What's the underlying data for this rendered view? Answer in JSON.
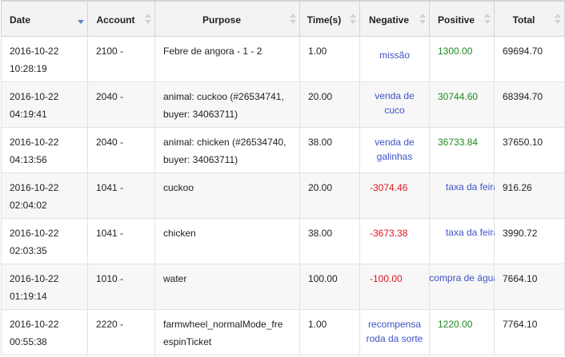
{
  "columns": [
    {
      "key": "date",
      "label": "Date",
      "sorted": true
    },
    {
      "key": "account",
      "label": "Account",
      "sorted": false
    },
    {
      "key": "purpose",
      "label": "Purpose",
      "sorted": false
    },
    {
      "key": "time",
      "label": "Time(s)",
      "sorted": false
    },
    {
      "key": "negative",
      "label": "Negative",
      "sorted": false
    },
    {
      "key": "positive",
      "label": "Positive",
      "sorted": false
    },
    {
      "key": "total",
      "label": "Total",
      "sorted": false
    }
  ],
  "rows": [
    {
      "date": "2016-10-22",
      "time_of_day": "10:28:19",
      "account": "2100 -",
      "purpose": [
        "Febre de angora - 1 - 2"
      ],
      "seconds": "1.00",
      "negative": "",
      "negative_note": "missão",
      "positive": "1300.00",
      "positive_note": "",
      "total": "69694.70"
    },
    {
      "date": "2016-10-22",
      "time_of_day": "04:19:41",
      "account": "2040 -",
      "purpose": [
        "animal: cuckoo (#26534741,",
        "buyer: 34063711)"
      ],
      "seconds": "20.00",
      "negative": "",
      "negative_note": "venda de cuco",
      "positive": "30744.60",
      "positive_note": "",
      "total": "68394.70"
    },
    {
      "date": "2016-10-22",
      "time_of_day": "04:13:56",
      "account": "2040 -",
      "purpose": [
        "animal: chicken (#26534740,",
        "buyer: 34063711)"
      ],
      "seconds": "38.00",
      "negative": "",
      "negative_note": "venda de galinhas",
      "positive": "36733.84",
      "positive_note": "",
      "total": "37650.10"
    },
    {
      "date": "2016-10-22",
      "time_of_day": "02:04:02",
      "account": "1041 -",
      "purpose": [
        "cuckoo"
      ],
      "seconds": "20.00",
      "negative": "-3074.46",
      "negative_note": "",
      "positive": "",
      "positive_note": "taxa da feira",
      "total": "916.26"
    },
    {
      "date": "2016-10-22",
      "time_of_day": "02:03:35",
      "account": "1041 -",
      "purpose": [
        "chicken"
      ],
      "seconds": "38.00",
      "negative": "-3673.38",
      "negative_note": "",
      "positive": "",
      "positive_note": "taxa da feira",
      "total": "3990.72"
    },
    {
      "date": "2016-10-22",
      "time_of_day": "01:19:14",
      "account": "1010 -",
      "purpose": [
        "water"
      ],
      "seconds": "100.00",
      "negative": "-100.00",
      "negative_note": "",
      "positive": "",
      "positive_note": "compra de água",
      "total": "7664.10"
    },
    {
      "date": "2016-10-22",
      "time_of_day": "00:55:38",
      "account": "2220 -",
      "purpose": [
        "farmwheel_normalMode_fre",
        "espinTicket"
      ],
      "seconds": "1.00",
      "negative": "",
      "negative_note": "recompensa roda da sorte",
      "positive": "1220.00",
      "positive_note": "",
      "total": "7764.10"
    }
  ],
  "colors": {
    "negative": "#e3141e",
    "positive": "#1e8a1e",
    "note": "#3f52c5",
    "sort_active": "#5a7cd9"
  },
  "icons": {
    "sort": "sort-arrows-icon",
    "sort_active": "sort-descending-icon"
  }
}
